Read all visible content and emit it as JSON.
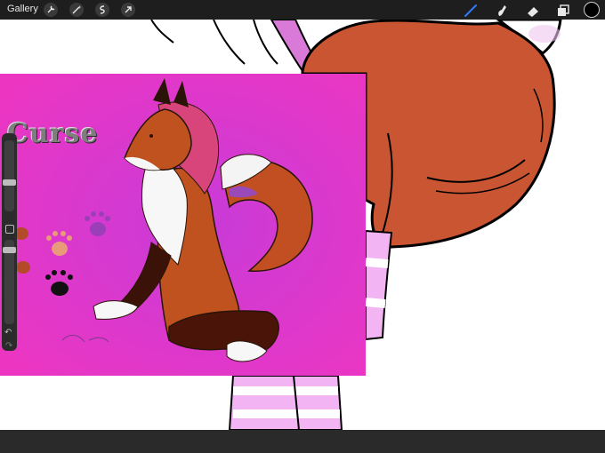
{
  "topbar": {
    "gallery_label": "Gallery",
    "left_tools": [
      "wrench-icon",
      "magic-wand-icon",
      "selection-icon",
      "transform-icon"
    ],
    "right_tools": [
      "brush-icon",
      "smudge-icon",
      "eraser-icon",
      "layers-icon"
    ],
    "active_tool": "brush",
    "current_color": "#000000"
  },
  "reference_image": {
    "title_text": "Curse",
    "signature": "Curse"
  },
  "sidebar": {
    "brush_size_slider": "brush-size",
    "opacity_slider": "opacity",
    "undo_label": "↶",
    "redo_label": "↷"
  },
  "colors": {
    "toolbar_bg": "#1e1e1e",
    "accent_blue": "#2f7cf6",
    "ref_bg": "#ea33c4",
    "fur_orange": "#c4541f",
    "stripe_pink": "#f2b4f2"
  }
}
